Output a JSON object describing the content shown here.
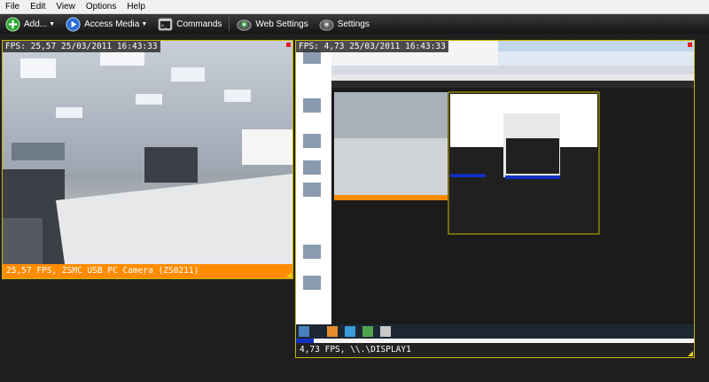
{
  "menu": {
    "items": [
      "File",
      "Edit",
      "View",
      "Options",
      "Help"
    ]
  },
  "toolbar": {
    "add_label": "Add...",
    "access_media_label": "Access Media",
    "commands_label": "Commands",
    "web_settings_label": "Web Settings",
    "settings_label": "Settings"
  },
  "panels": {
    "webcam": {
      "overlay": "FPS: 25,57 25/03/2011 16:43:33",
      "caption": "25,57 FPS, ZSMC USB PC Camera (ZS0211)"
    },
    "display": {
      "overlay": "FPS: 4,73 25/03/2011 16:43:33",
      "caption": "4,73 FPS, \\\\.\\DISPLAY1"
    }
  },
  "colors": {
    "accent_orange": "#ff8c00",
    "panel_border": "#c8b400",
    "background": "#1e1e1e"
  }
}
